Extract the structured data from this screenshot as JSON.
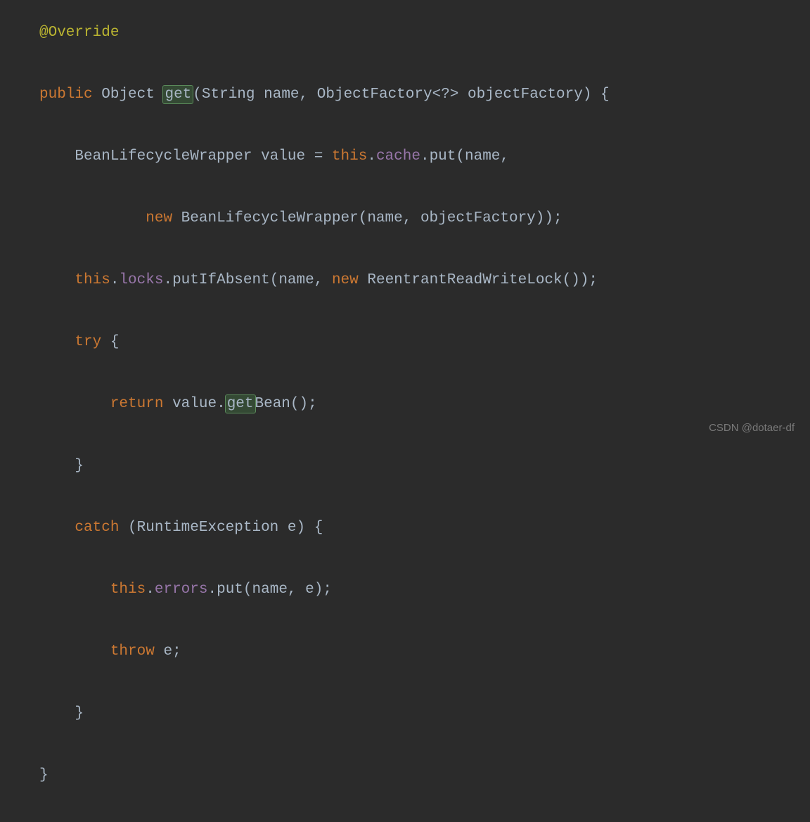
{
  "code": {
    "annotation": "@Override",
    "public": "public",
    "object_type": "Object",
    "method_get": "get",
    "string_type": "String",
    "param_name": "name",
    "factory_type": "ObjectFactory",
    "generic": "<?>",
    "param_factory": "objectFactory",
    "wrapper_type": "BeanLifecycleWrapper",
    "value_var": "value",
    "this_kw": "this",
    "cache_field": "cache",
    "put_method": "put",
    "new_kw": "new",
    "locks_field": "locks",
    "putIfAbsent": "putIfAbsent",
    "reentrant_type": "ReentrantReadWriteLock",
    "try_kw": "try",
    "return_kw": "return",
    "getBean_get": "get",
    "getBean_bean": "Bean",
    "catch_kw": "catch",
    "runtime_ex": "RuntimeException",
    "ex_var": "e",
    "errors_field": "errors",
    "throw_kw": "throw"
  },
  "watermark": "CSDN @dotaer-df"
}
